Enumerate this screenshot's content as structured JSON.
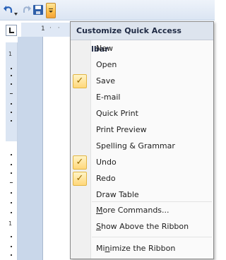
{
  "window": {
    "menu_title": "Customize Quick Access Toolbar"
  },
  "ruler": {
    "h_number": "1",
    "v_numbers": [
      "1",
      "1"
    ]
  },
  "icons": {
    "undo": "undo-icon",
    "undo_dropdown": "dropdown-arrow-icon",
    "redo": "redo-icon",
    "save": "save-icon",
    "customize": "customize-toolbar-icon",
    "check": "checkmark-icon"
  },
  "colors": {
    "menu_header_bg": "#dde4ee",
    "check_bg": "#ffd77a",
    "check_mark": "#9a6b00",
    "customize_btn": "#ffc24d"
  },
  "menu": {
    "items": [
      {
        "label": "New",
        "checked": false
      },
      {
        "label": "Open",
        "checked": false
      },
      {
        "label": "Save",
        "checked": true
      },
      {
        "label": "E-mail",
        "checked": false
      },
      {
        "label": "Quick Print",
        "checked": false
      },
      {
        "label": "Print Preview",
        "checked": false
      },
      {
        "label": "Spelling & Grammar",
        "checked": false
      },
      {
        "label": "Undo",
        "checked": true
      },
      {
        "label": "Redo",
        "checked": true
      },
      {
        "label": "Draw Table",
        "checked": false
      }
    ],
    "more_commands": {
      "pre": "",
      "key": "M",
      "post": "ore Commands..."
    },
    "show_above": {
      "pre": "",
      "key": "S",
      "post": "how Above the Ribbon"
    },
    "minimize": {
      "pre": "Mi",
      "key": "n",
      "post": "imize the Ribbon"
    },
    "check_glyph": "✓"
  }
}
